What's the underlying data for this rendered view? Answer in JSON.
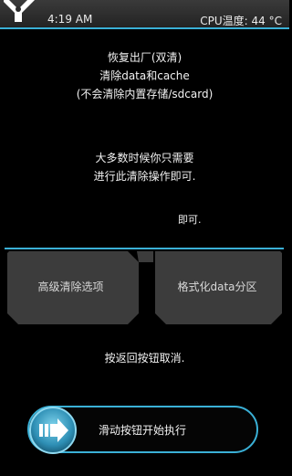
{
  "status_bar": {
    "time": "4:19 AM",
    "cpu_temp": "CPU温度: 44 °C",
    "logo_icon": "twrp-logo-icon"
  },
  "info": {
    "line1": "恢复出厂(双清)",
    "line2": "清除data和cache",
    "line3": "(不会清除内置存储/sdcard)",
    "line4": "大多数时候你只需要",
    "line5": "进行此清除操作即可."
  },
  "ok_label": "即可.",
  "buttons": {
    "advanced_wipe": "高级清除选项",
    "format_data": "格式化data分区"
  },
  "cancel_hint": "按返回按钮取消.",
  "slider": {
    "label": "滑动按钮开始执行",
    "icon": "double-arrow-right-icon"
  },
  "colors": {
    "accent": "#3ab0d6",
    "button_bg": "#3c3c3c",
    "background": "#000000"
  }
}
